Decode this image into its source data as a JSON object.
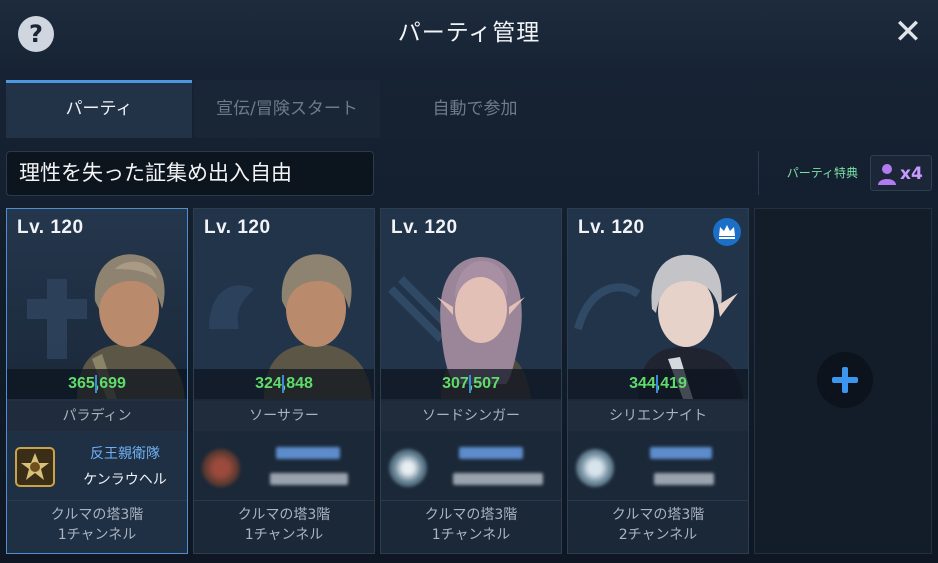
{
  "header": {
    "title": "パーティ管理",
    "help_glyph": "?",
    "close_glyph": "✕"
  },
  "tabs": [
    {
      "label": "パーティ",
      "active": true
    },
    {
      "label": "宣伝/冒険スタート",
      "active": false
    },
    {
      "label": "自動で参加",
      "active": false
    }
  ],
  "party": {
    "name": "理性を失った証集め出入自由",
    "bonus_label": "パーティ特典",
    "bonus_count": "x4"
  },
  "members": [
    {
      "level": "Lv. 120",
      "power": "365,699",
      "class": "パラディン",
      "guild": "反王親衛隊",
      "name": "ケンラウヘル",
      "location_line1": "クルマの塔3階",
      "location_line2": "1チャンネル",
      "selected": true,
      "leader": false,
      "info_blurred": false
    },
    {
      "level": "Lv. 120",
      "power": "324,848",
      "class": "ソーサラー",
      "location_line1": "クルマの塔3階",
      "location_line2": "1チャンネル",
      "selected": false,
      "leader": false,
      "info_blurred": true
    },
    {
      "level": "Lv. 120",
      "power": "307,507",
      "class": "ソードシンガー",
      "location_line1": "クルマの塔3階",
      "location_line2": "1チャンネル",
      "selected": false,
      "leader": false,
      "info_blurred": true
    },
    {
      "level": "Lv. 120",
      "power": "344,419",
      "class": "シリエンナイト",
      "location_line1": "クルマの塔3階",
      "location_line2": "2チャンネル",
      "selected": false,
      "leader": true,
      "info_blurred": true
    }
  ],
  "icons": {
    "help": "question-icon",
    "close": "close-icon",
    "bonus": "person-icon",
    "leader": "crown-icon",
    "add": "plus-icon"
  },
  "colors": {
    "accent": "#4d98e0",
    "power": "#5fdc6a",
    "guild": "#6fb1f2",
    "bonus": "#7ce0a6",
    "bonus_count": "#c79bff"
  }
}
